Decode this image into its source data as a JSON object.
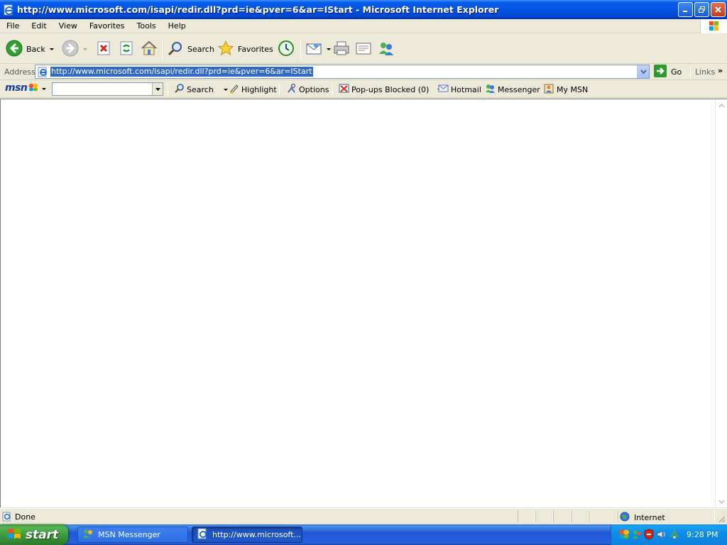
{
  "window": {
    "title": "http://www.microsoft.com/isapi/redir.dll?prd=ie&pver=6&ar=IStart - Microsoft Internet Explorer"
  },
  "menu": {
    "items": [
      "File",
      "Edit",
      "View",
      "Favorites",
      "Tools",
      "Help"
    ]
  },
  "toolbar": {
    "back_label": "Back",
    "search_label": "Search",
    "favorites_label": "Favorites"
  },
  "address": {
    "label": "Address",
    "url": "http://www.microsoft.com/isapi/redir.dll?prd=ie&pver=6&ar=IStart",
    "go_label": "Go",
    "links_label": "Links"
  },
  "msn_toolbar": {
    "logo": "msn",
    "search_label": "Search",
    "highlight_label": "Highlight",
    "options_label": "Options",
    "popups_label": "Pop-ups Blocked (0)",
    "hotmail_label": "Hotmail",
    "messenger_label": "Messenger",
    "mymsn_label": "My MSN"
  },
  "status": {
    "text": "Done",
    "zone": "Internet"
  },
  "taskbar": {
    "start_label": "start",
    "tasks": [
      {
        "label": "MSN Messenger",
        "active": false
      },
      {
        "label": "http://www.microsoft...",
        "active": true
      }
    ],
    "clock": "9:28 PM"
  },
  "colors": {
    "titlebar": "#0054e3",
    "selection": "#316ac5",
    "taskbar": "#2157d7",
    "start_button": "#3a953a",
    "tray": "#0e89e6"
  }
}
